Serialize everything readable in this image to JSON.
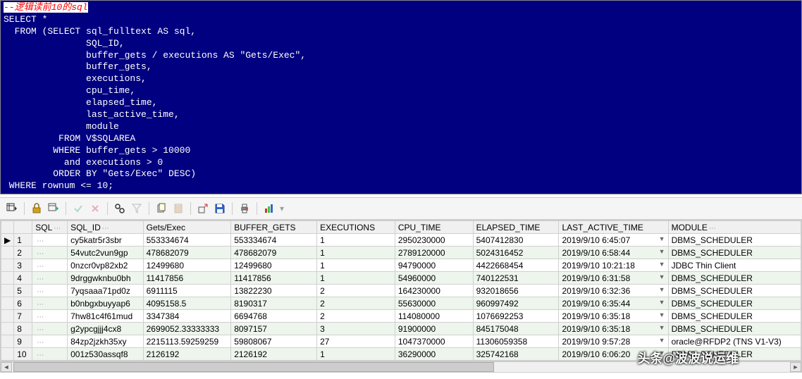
{
  "editor": {
    "comment": "--逻辑读前10的sql",
    "sql": "SELECT *\n  FROM (SELECT sql_fulltext AS sql,\n               SQL_ID,\n               buffer_gets / executions AS \"Gets/Exec\",\n               buffer_gets,\n               executions,\n               cpu_time,\n               elapsed_time,\n               last_active_time,\n               module\n          FROM V$SQLAREA\n         WHERE buffer_gets > 10000\n           and executions > 0\n         ORDER BY \"Gets/Exec\" DESC)\n WHERE rownum <= 10;"
  },
  "columns": [
    "SQL",
    "SQL_ID",
    "Gets/Exec",
    "BUFFER_GETS",
    "EXECUTIONS",
    "CPU_TIME",
    "ELAPSED_TIME",
    "LAST_ACTIVE_TIME",
    "MODULE"
  ],
  "rows": [
    {
      "n": 1,
      "sql": "<CLOB>",
      "sql_id": "cy5katr5r3sbr",
      "gets_exec": "553334674",
      "buffer_gets": "553334674",
      "executions": "1",
      "cpu_time": "2950230000",
      "elapsed_time": "5407412830",
      "last_active": "2019/9/10 6:45:07",
      "module": "DBMS_SCHEDULER"
    },
    {
      "n": 2,
      "sql": "<CLOB>",
      "sql_id": "54vutc2vun9gp",
      "gets_exec": "478682079",
      "buffer_gets": "478682079",
      "executions": "1",
      "cpu_time": "2789120000",
      "elapsed_time": "5024316452",
      "last_active": "2019/9/10 6:58:44",
      "module": "DBMS_SCHEDULER"
    },
    {
      "n": 3,
      "sql": "<CLOB>",
      "sql_id": "0nzcr0vp82xb2",
      "gets_exec": "12499680",
      "buffer_gets": "12499680",
      "executions": "1",
      "cpu_time": "94790000",
      "elapsed_time": "4422668454",
      "last_active": "2019/9/10 10:21:18",
      "module": "JDBC Thin Client"
    },
    {
      "n": 4,
      "sql": "<CLOB>",
      "sql_id": "9drggwknbu0bh",
      "gets_exec": "11417856",
      "buffer_gets": "11417856",
      "executions": "1",
      "cpu_time": "54960000",
      "elapsed_time": "740122531",
      "last_active": "2019/9/10 6:31:58",
      "module": "DBMS_SCHEDULER"
    },
    {
      "n": 5,
      "sql": "<CLOB>",
      "sql_id": "7yqsaaa71pd0z",
      "gets_exec": "6911115",
      "buffer_gets": "13822230",
      "executions": "2",
      "cpu_time": "164230000",
      "elapsed_time": "932018656",
      "last_active": "2019/9/10 6:32:36",
      "module": "DBMS_SCHEDULER"
    },
    {
      "n": 6,
      "sql": "<CLOB>",
      "sql_id": "b0nbgxbuyyap6",
      "gets_exec": "4095158.5",
      "buffer_gets": "8190317",
      "executions": "2",
      "cpu_time": "55630000",
      "elapsed_time": "960997492",
      "last_active": "2019/9/10 6:35:44",
      "module": "DBMS_SCHEDULER"
    },
    {
      "n": 7,
      "sql": "<CLOB>",
      "sql_id": "7hw81c4f61mud",
      "gets_exec": "3347384",
      "buffer_gets": "6694768",
      "executions": "2",
      "cpu_time": "114080000",
      "elapsed_time": "1076692253",
      "last_active": "2019/9/10 6:35:18",
      "module": "DBMS_SCHEDULER"
    },
    {
      "n": 8,
      "sql": "<CLOB>",
      "sql_id": "g2ypcgjjj4cx8",
      "gets_exec": "2699052.33333333",
      "buffer_gets": "8097157",
      "executions": "3",
      "cpu_time": "91900000",
      "elapsed_time": "845175048",
      "last_active": "2019/9/10 6:35:18",
      "module": "DBMS_SCHEDULER"
    },
    {
      "n": 9,
      "sql": "<CLOB>",
      "sql_id": "84zp2jzkh35xy",
      "gets_exec": "2215113.59259259",
      "buffer_gets": "59808067",
      "executions": "27",
      "cpu_time": "1047370000",
      "elapsed_time": "11306059358",
      "last_active": "2019/9/10 9:57:28",
      "module": "oracle@RFDP2 (TNS V1-V3)"
    },
    {
      "n": 10,
      "sql": "<CLOB>",
      "sql_id": "001z530assqf8",
      "gets_exec": "2126192",
      "buffer_gets": "2126192",
      "executions": "1",
      "cpu_time": "36290000",
      "elapsed_time": "325742168",
      "last_active": "2019/9/10 6:06:20",
      "module": "DBMS_SCHEDULER"
    }
  ],
  "watermark": "头条@波波说运维"
}
